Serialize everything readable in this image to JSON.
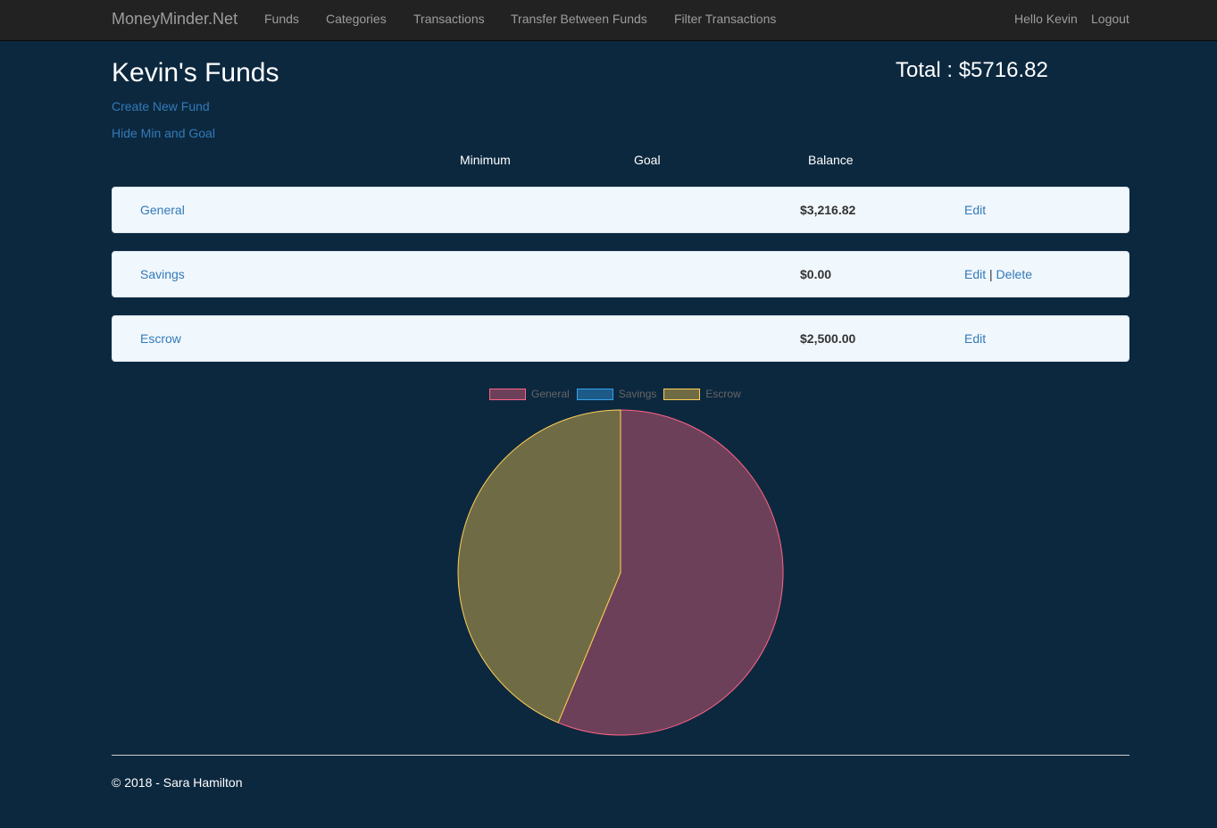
{
  "navbar": {
    "brand": "MoneyMinder.Net",
    "links": [
      "Funds",
      "Categories",
      "Transactions",
      "Transfer Between Funds",
      "Filter Transactions"
    ],
    "greeting": "Hello Kevin",
    "logout": "Logout"
  },
  "page": {
    "title": "Kevin's Funds",
    "total": "Total : $5716.82",
    "create_link": "Create New Fund",
    "toggle_link": "Hide Min and Goal"
  },
  "table": {
    "headers": {
      "minimum": "Minimum",
      "goal": "Goal",
      "balance": "Balance"
    },
    "rows": [
      {
        "name": "General",
        "balance": "$3,216.82",
        "edit": "Edit",
        "delete": ""
      },
      {
        "name": "Savings",
        "balance": "$0.00",
        "edit": "Edit",
        "separator": "|",
        "delete": "Delete"
      },
      {
        "name": "Escrow",
        "balance": "$2,500.00",
        "edit": "Edit",
        "delete": ""
      }
    ]
  },
  "chart_data": {
    "type": "pie",
    "categories": [
      "General",
      "Savings",
      "Escrow"
    ],
    "values": [
      3216.82,
      0.0,
      2500.0
    ],
    "colors": {
      "General": {
        "fill": "#6d4059",
        "stroke": "#ff6384"
      },
      "Savings": {
        "fill": "#1d5a87",
        "stroke": "#36a2eb"
      },
      "Escrow": {
        "fill": "#6f6c45",
        "stroke": "#ffce56"
      }
    },
    "legend_position": "top"
  },
  "footer": {
    "text": "© 2018 - Sara Hamilton"
  },
  "theme": {
    "background": "#0c283f",
    "navbar": "#222222",
    "link": "#337ab7",
    "row_background": "#f0f7fd"
  }
}
